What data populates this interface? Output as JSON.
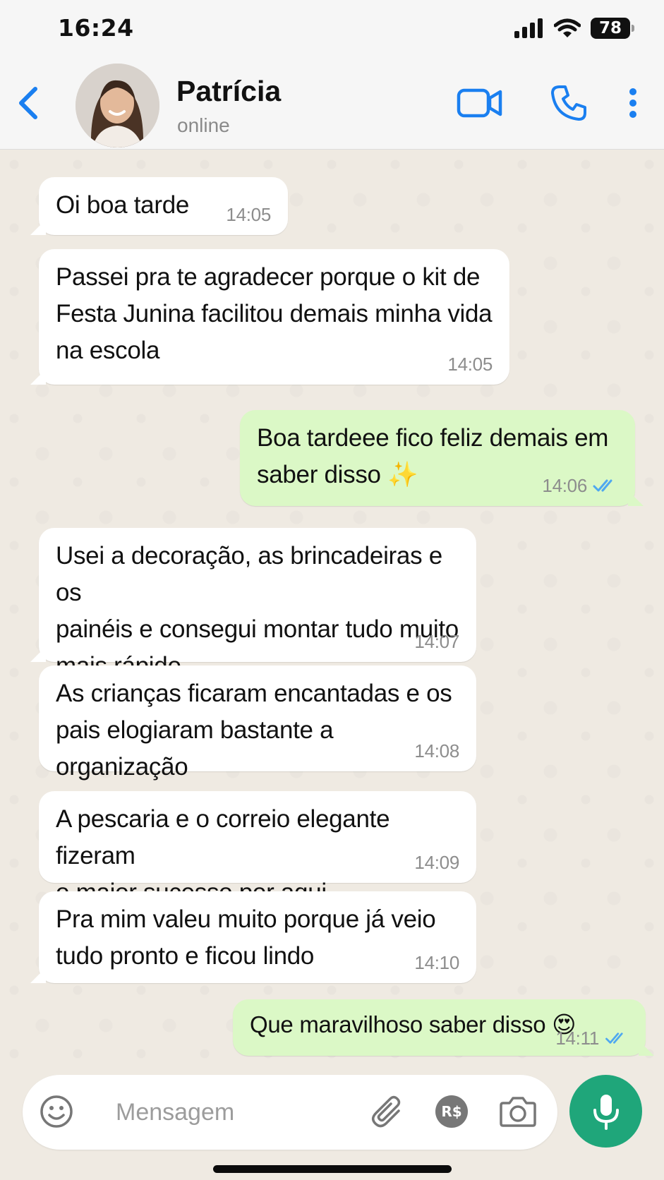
{
  "status_bar": {
    "time": "16:24",
    "battery": "78"
  },
  "header": {
    "contact_name": "Patrícia",
    "contact_status": "online",
    "accent_color": "#1a7ff0"
  },
  "messages": [
    {
      "direction": "incoming",
      "text": "Oi boa tarde",
      "time": "14:05"
    },
    {
      "direction": "incoming",
      "text": "Passei pra te agradecer porque o kit de\nFesta Junina facilitou demais minha vida\nna escola",
      "time": "14:05"
    },
    {
      "direction": "outgoing",
      "text": "Boa tardeee fico feliz demais em\nsaber disso ✨",
      "time": "14:06",
      "read": true
    },
    {
      "direction": "incoming",
      "text": "Usei a decoração, as brincadeiras e os\npainéis e consegui montar tudo muito\nmais rápido",
      "time": "14:07"
    },
    {
      "direction": "incoming",
      "text": "As crianças ficaram encantadas e os\npais elogiaram bastante a organização",
      "time": "14:08"
    },
    {
      "direction": "incoming",
      "text": "A pescaria e o correio elegante fizeram\no maior sucesso por aqui",
      "time": "14:09"
    },
    {
      "direction": "incoming",
      "text": "Pra mim valeu muito porque já veio\ntudo pronto e ficou lindo",
      "time": "14:10"
    },
    {
      "direction": "outgoing",
      "text": "Que maravilhoso saber disso 😍",
      "time": "14:11",
      "read": true
    }
  ],
  "composer": {
    "placeholder": "Mensagem",
    "payment_icon_label": "R$"
  },
  "colors": {
    "incoming_bubble": "#ffffff",
    "outgoing_bubble": "#dbf8c6",
    "read_ticks": "#4fa8f0",
    "mic_button": "#1fa67a",
    "chat_background": "#efeae2"
  },
  "icons": [
    "back-icon",
    "video-call-icon",
    "phone-icon",
    "more-icon",
    "emoji-icon",
    "attach-icon",
    "payment-icon",
    "camera-icon",
    "mic-icon",
    "double-check-icon"
  ]
}
